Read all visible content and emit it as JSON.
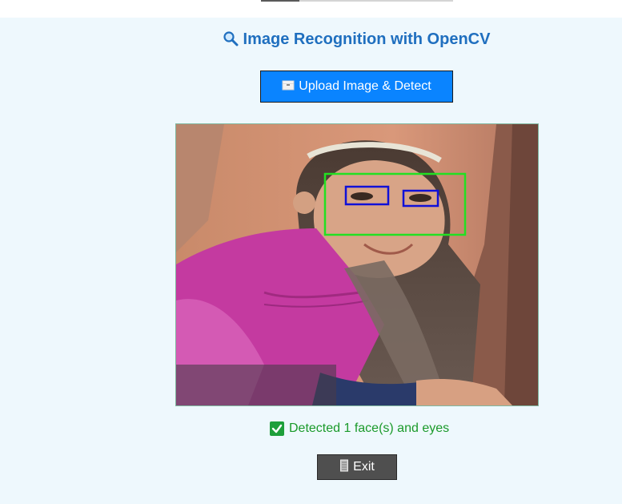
{
  "app": {
    "title": "Image Recognition with OpenCV",
    "title_icon": "magnifier-icon"
  },
  "buttons": {
    "upload_label": "Upload Image & Detect",
    "upload_icon": "package-icon",
    "exit_label": "Exit",
    "exit_icon": "door-icon"
  },
  "image": {
    "face_box_color": "#22e022",
    "eye_box_color": "#1010d8"
  },
  "status": {
    "text": "Detected 1 face(s) and eyes",
    "icon": "checkmark-icon",
    "color": "#1a9a2a"
  },
  "colors": {
    "background": "#eef8fd",
    "title": "#1f6fbf",
    "upload_button": "#0a84ff",
    "exit_button": "#4f4f4f"
  }
}
